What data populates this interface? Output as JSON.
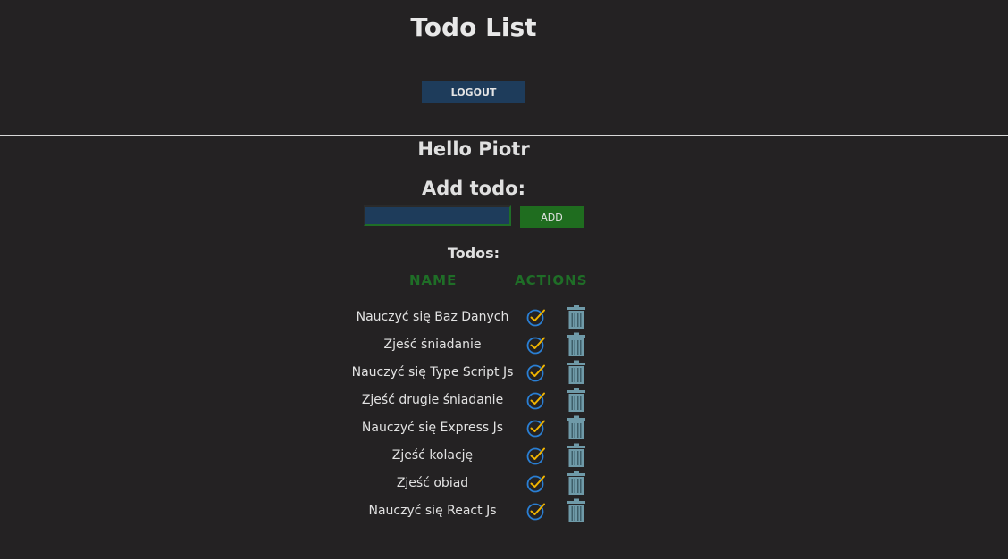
{
  "header": {
    "title": "Todo List",
    "logout_label": "LOGOUT"
  },
  "greeting": "Hello Piotr",
  "add_form": {
    "heading": "Add todo:",
    "input_value": "",
    "add_label": "ADD"
  },
  "todos": {
    "heading": "Todos:",
    "columns": [
      "NAME",
      "ACTIONS"
    ],
    "items": [
      {
        "name": "Nauczyć się Baz Danych"
      },
      {
        "name": "Zjeść śniadanie"
      },
      {
        "name": "Nauczyć się Type Script Js"
      },
      {
        "name": "Zjeść drugie śniadanie"
      },
      {
        "name": "Nauczyć się Express Js"
      },
      {
        "name": "Zjeść kolację"
      },
      {
        "name": "Zjeść obiad"
      },
      {
        "name": "Nauczyć się React Js"
      }
    ],
    "icons": {
      "complete": "check-circle-icon",
      "delete": "trash-icon"
    }
  },
  "colors": {
    "background": "#242223",
    "logout_button": "#1e3c5b",
    "add_button": "#1f6d1f",
    "column_header": "#1f6e27",
    "check_circle": "#2a7fd4",
    "check_mark": "#f0b400",
    "trash": "#6f9aa8"
  }
}
